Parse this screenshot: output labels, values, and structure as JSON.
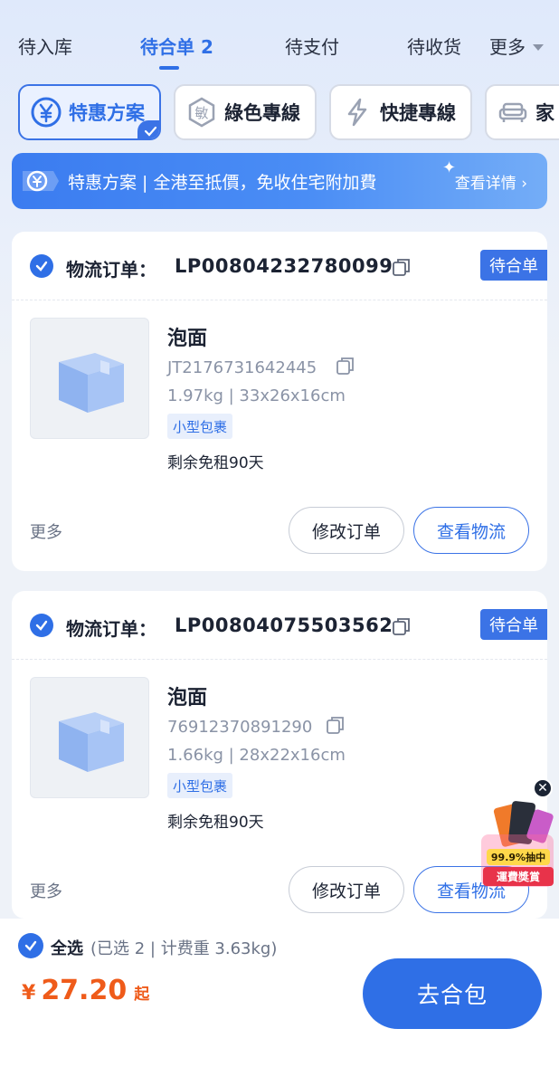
{
  "tabs": [
    {
      "label": "待入库"
    },
    {
      "label": "待合单",
      "count": "2",
      "active": true
    },
    {
      "label": "待支付"
    },
    {
      "label": "待收货"
    },
    {
      "label": "更多"
    }
  ],
  "services": [
    {
      "label": "特惠方案",
      "icon": "yen-shield-icon",
      "selected": true
    },
    {
      "label": "綠色專線",
      "icon": "sensitive-badge-icon"
    },
    {
      "label": "快捷專線",
      "icon": "lightning-icon"
    },
    {
      "label": "家",
      "icon": "sofa-icon"
    }
  ],
  "promo": {
    "text": "特惠方案 | 全港至抵價，免收住宅附加費",
    "link": "查看详情"
  },
  "orders": [
    {
      "order_label": "物流订单：",
      "order_no": "LP00804232780099",
      "status": "待合单",
      "item_name": "泡面",
      "tracking": "JT2176731642445",
      "weight_dims": "1.97kg | 33x26x16cm",
      "size_tag": "小型包裹",
      "free_days": "剩余免租90天",
      "more": "更多",
      "btn_modify": "修改订单",
      "btn_track": "查看物流"
    },
    {
      "order_label": "物流订单：",
      "order_no": "LP00804075503562",
      "status": "待合单",
      "item_name": "泡面",
      "tracking": "76912370891290",
      "weight_dims": "1.66kg | 28x22x16cm",
      "size_tag": "小型包裹",
      "free_days": "剩余免租90天",
      "more": "更多",
      "btn_modify": "修改订单",
      "btn_track": "查看物流"
    }
  ],
  "float_promo": {
    "line1": "99.9%抽中",
    "line2": "運費獎賞"
  },
  "bottom": {
    "select_all": "全选",
    "select_info": "(已选 2 | 计费重 3.63kg)",
    "currency": "¥",
    "amount": "27.20",
    "suffix": "起",
    "submit": "去合包"
  },
  "colors": {
    "accent": "#2f6fe6",
    "price": "#ef5b1a"
  }
}
